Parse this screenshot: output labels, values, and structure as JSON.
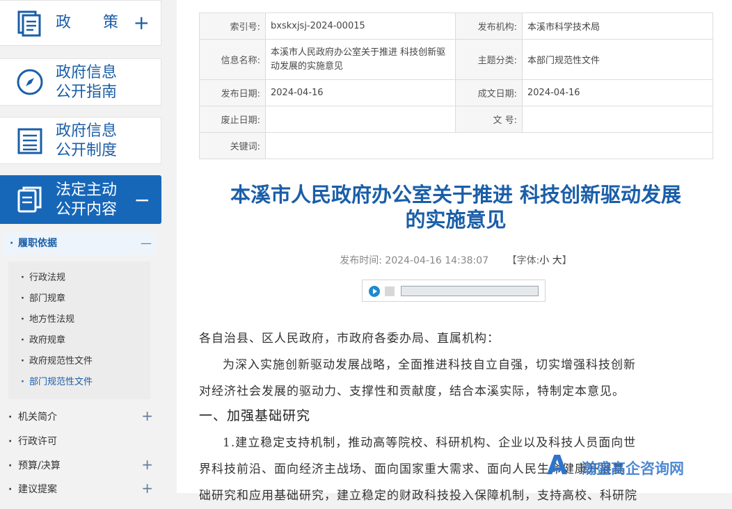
{
  "sidebar": {
    "cards": [
      {
        "line1": "政",
        "line2": "策",
        "toggle": "+",
        "icon": "document-icon"
      },
      {
        "line1": "政府信息",
        "line2": "公开指南",
        "icon": "compass-icon"
      },
      {
        "line1": "政府信息",
        "line2": "公开制度",
        "icon": "list-icon"
      },
      {
        "line1": "法定主动",
        "line2": "公开内容",
        "toggle": "−",
        "icon": "copy-icon"
      }
    ],
    "subsection": {
      "label": "履职依据",
      "toggle": "—"
    },
    "subitems": [
      "行政法规",
      "部门规章",
      "地方性法规",
      "政府规章",
      "政府规范性文件",
      "部门规范性文件"
    ],
    "menu": [
      {
        "label": "机关简介",
        "toggle": "+"
      },
      {
        "label": "行政许可",
        "toggle": ""
      },
      {
        "label": "预算/决算",
        "toggle": "+"
      },
      {
        "label": "建议提案",
        "toggle": "+"
      }
    ]
  },
  "meta": {
    "index_label": "索引号:",
    "index_value": "bxskxjsj-2024-00015",
    "org_label": "发布机构:",
    "org_value": "本溪市科学技术局",
    "name_label": "信息名称:",
    "name_value": "本溪市人民政府办公室关于推进 科技创新驱动发展的实施意见",
    "topic_label": "主题分类:",
    "topic_value": "本部门规范性文件",
    "pub_label": "发布日期:",
    "pub_value": "2024-04-16",
    "made_label": "成文日期:",
    "made_value": "2024-04-16",
    "abolish_label": "废止日期:",
    "abolish_value": "",
    "docno_label": "文 号:",
    "docno_value": "",
    "keyword_label": "关键词:",
    "keyword_value": ""
  },
  "article": {
    "title_line1": "本溪市人民政府办公室关于推进 科技创新驱动发展",
    "title_line2": "的实施意见",
    "pub_time_label": "发布时间:",
    "pub_time": "2024-04-16 14:38:07",
    "font_label": "【字体:",
    "font_small": "小",
    "font_big": "大",
    "font_end": "】",
    "p1": "各自治县、区人民政府，市政府各委办局、直属机构：",
    "p2a": "为深入实施创新驱动发展战略，全面推进科技自立自强，切实增强科技创新",
    "p2b": "对经济社会发展的驱动力、支撑性和贡献度，结合本溪实际，特制定本意见。",
    "h1": "一、加强基础研究",
    "p3a": "1.建立稳定支持机制，推动高等院校、科研机构、企业以及科技人员面向世",
    "p3b": "界科技前沿、面向经济主战场、面向国家重大需求、面向人民生命健康开展基",
    "p3c": "础研究和应用基础研究，建立稳定的财政科技投入保障机制，支持高校、科研院"
  },
  "watermark": {
    "logo": "A",
    "text": "瀚盛高企咨询网"
  },
  "colors": {
    "brand_blue": "#1767b9",
    "title_blue": "#1a5ea8"
  }
}
